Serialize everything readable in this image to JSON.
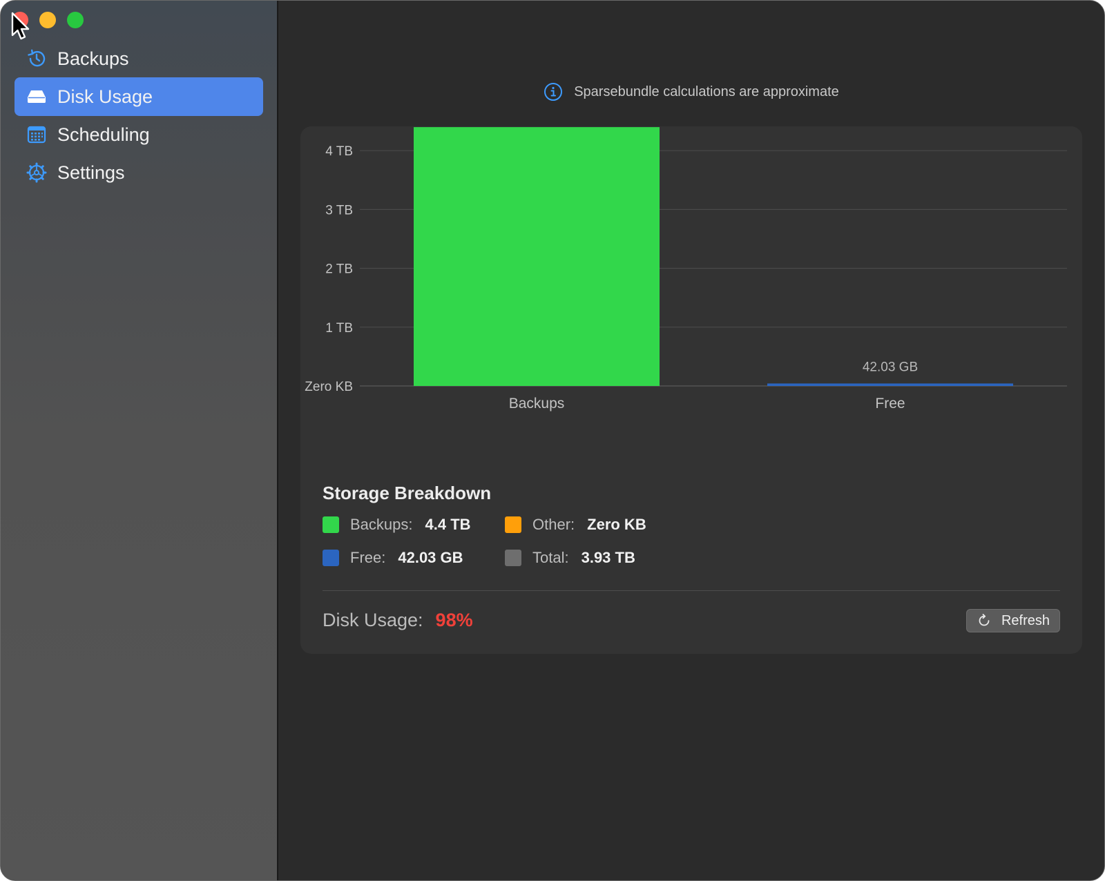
{
  "sidebar": {
    "items": [
      {
        "label": "Backups",
        "icon": "clock-history-icon"
      },
      {
        "label": "Disk Usage",
        "icon": "internal-drive-icon",
        "selected": true
      },
      {
        "label": "Scheduling",
        "icon": "calendar-icon"
      },
      {
        "label": "Settings",
        "icon": "gear-icon"
      }
    ]
  },
  "notice": {
    "text": "Sparsebundle calculations are approximate",
    "icon": "info-circle-icon"
  },
  "chart_data": {
    "type": "bar",
    "categories": [
      "Backups",
      "Free"
    ],
    "values": [
      4.4,
      0.04203
    ],
    "unit": "TB",
    "bar_colors": [
      "#32d74b",
      "#2b65c0"
    ],
    "data_labels": [
      "",
      "42.03 GB"
    ],
    "y_ticks": [
      {
        "value": 0,
        "label": "Zero KB"
      },
      {
        "value": 1,
        "label": "1 TB"
      },
      {
        "value": 2,
        "label": "2 TB"
      },
      {
        "value": 3,
        "label": "3 TB"
      },
      {
        "value": 4,
        "label": "4 TB"
      }
    ],
    "ylim": [
      0,
      4.4
    ],
    "grid": true
  },
  "breakdown": {
    "title": "Storage Breakdown",
    "rows": [
      [
        {
          "label": "Backups:",
          "value": "4.4 TB",
          "color": "#32d74b"
        },
        {
          "label": "Other:",
          "value": "Zero KB",
          "color": "#ff9f0a"
        }
      ],
      [
        {
          "label": "Free:",
          "value": "42.03 GB",
          "color": "#2b65c0"
        },
        {
          "label": "Total:",
          "value": "3.93 TB",
          "color": "#6e6e6e"
        }
      ]
    ]
  },
  "usage": {
    "label": "Disk Usage:",
    "value": "98%",
    "value_color": "#f0413a"
  },
  "refresh": {
    "label": "Refresh",
    "icon": "refresh-icon"
  }
}
